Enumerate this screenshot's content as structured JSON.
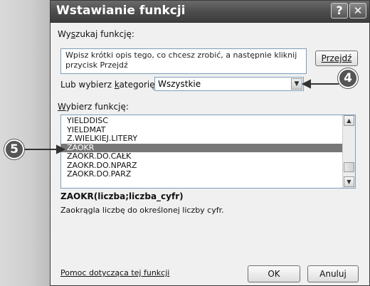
{
  "dialog": {
    "title": "Wstawianie funkcji",
    "help_button": "?",
    "close_button": "✕",
    "search_label_pre": "Wy",
    "search_label_u": "s",
    "search_label_post": "zukaj funkcję:",
    "search_text": "Wpisz krótki opis tego, co chcesz zrobić, a następnie kliknij przycisk Przejdź",
    "go_button": "Przejdź",
    "category_label_pre": "Lub wybierz ",
    "category_label_u": "k",
    "category_label_post": "ategorię:",
    "category_value": "Wszystkie",
    "functions_label_u": "W",
    "functions_label_post": "ybierz funkcję:",
    "functions": [
      "YIELDDISC",
      "YIELDMAT",
      "Z.WIELKIEJ.LITERY",
      "ZAOKR",
      "ZAOKR.DO.CAŁK",
      "ZAOKR.DO.NPARZ",
      "ZAOKR.DO.PARZ"
    ],
    "selected_function": "ZAOKR",
    "signature": "ZAOKR(liczba;liczba_cyfr)",
    "description": "Zaokrągla liczbę do określonej liczby cyfr.",
    "help_link": "Pomoc dotycząca tej funkcji",
    "ok_button": "OK",
    "cancel_button": "Anuluj"
  },
  "callouts": {
    "step4": "4",
    "step5": "5"
  },
  "colors": {
    "callout": "#555555",
    "selection": "#777777",
    "titlebar": "#4b4b4b"
  }
}
